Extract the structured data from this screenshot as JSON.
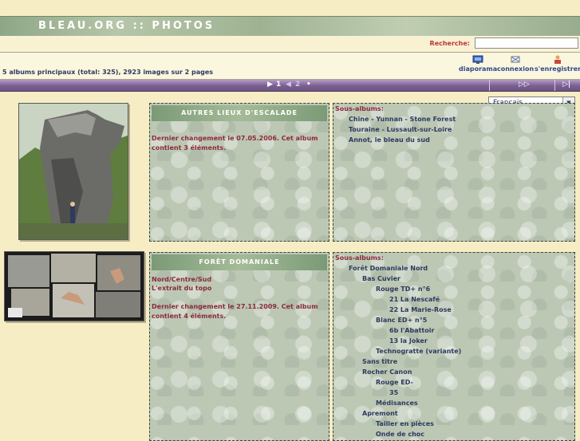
{
  "header": {
    "title": "BLEAU.ORG :: PHOTOS"
  },
  "search": {
    "label": "Recherche:",
    "value": ""
  },
  "info": {
    "summary": "5 albums principaux (total: 325), 2923 images sur 2 pages",
    "links": [
      {
        "label": "diaporama",
        "icon": "slideshow-icon"
      },
      {
        "label": "connexion",
        "icon": "login-icon"
      },
      {
        "label": "s'enregistrer",
        "icon": "register-icon"
      }
    ]
  },
  "pagination": {
    "current": "1",
    "next": "2",
    "first": "▶",
    "prev": "◀",
    "dot": "•",
    "fast_forward": "▷▷",
    "last": "▷|"
  },
  "language": {
    "selected": "Français"
  },
  "albums": [
    {
      "title": "AUTRES LIEUX D'ESCALADE",
      "description": "",
      "changed": "Dernier changement le 07.05.2006. Cet album contient 3 éléments.",
      "sub_label": "Sous-albums:",
      "subalbums": [
        "Chine - Yunnan - Stone Forest",
        "Touraine - Lussault-sur-Loire",
        "Annot, le bleau du sud"
      ]
    },
    {
      "title": "FORÊT DOMANIALE",
      "description_1": "Nord/Centre/Sud",
      "description_2": "L'extrait du topo",
      "changed": "Dernier changement le 27.11.2009. Cet album contient 4 éléments.",
      "sub_label": "Sous-albums:",
      "subalbums": [
        "Forêt Domaniale Nord",
        "Bas Cuvier",
        "Rouge TD+ n°6",
        "21 La Nescafé",
        "22 La Marie-Rose",
        "Blanc ED+ n°5",
        "6b l'Abattoir",
        "13 la Joker",
        "Technogratte (variante)",
        "Sans titre",
        "Rocher Canon",
        "Rouge ED-",
        "35",
        "Médisances",
        "Apremont",
        "Tailler en pièces",
        "Onde de choc"
      ]
    }
  ]
}
